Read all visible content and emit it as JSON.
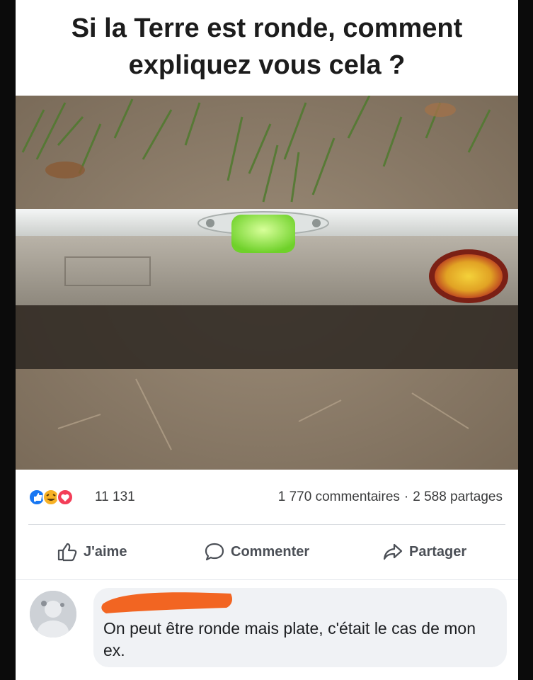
{
  "post": {
    "title": "Si la Terre est ronde, comment expliquez vous cela ?"
  },
  "photo": {
    "description_icon": "spirit-level-photo-icon"
  },
  "stats": {
    "reaction_count": "11 131",
    "comments": "1 770 commentaires",
    "separator": "·",
    "shares": "2 588 partages",
    "reaction_icons": [
      "like-reaction-icon",
      "haha-reaction-icon",
      "love-reaction-icon"
    ]
  },
  "actions": {
    "like_label": "J'aime",
    "comment_label": "Commenter",
    "share_label": "Partager"
  },
  "comment": {
    "text": "On peut être ronde mais plate, c'était le cas de mon ex."
  },
  "colors": {
    "like_blue": "#1877f2",
    "love_red": "#f33e58",
    "haha_yellow": "#f7b125",
    "redaction_orange": "#f26522"
  }
}
